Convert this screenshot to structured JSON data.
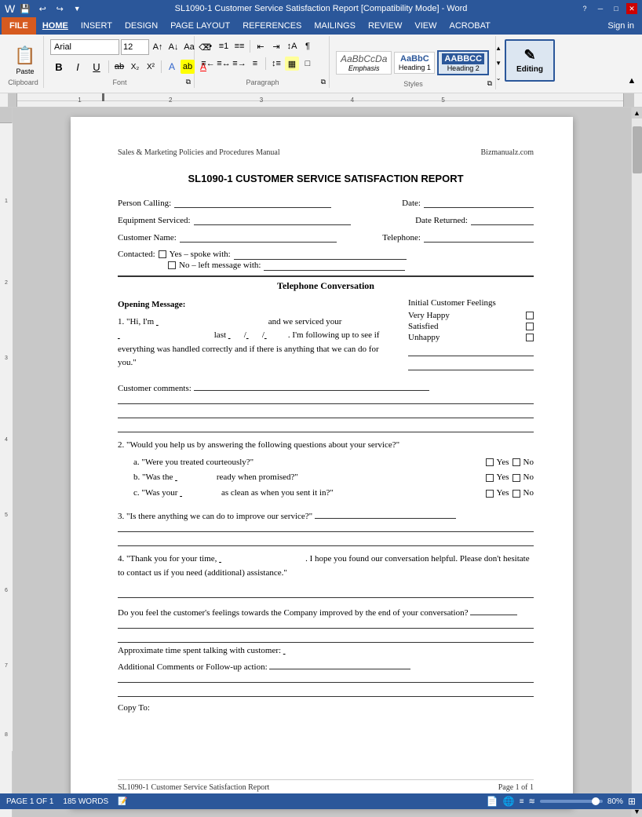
{
  "titleBar": {
    "quickAccess": [
      "save",
      "undo",
      "redo"
    ],
    "title": "SL1090-1 Customer Service Satisfaction Report [Compatibility Mode] - Word",
    "controls": [
      "minimize",
      "restore",
      "close"
    ],
    "helpIcon": "?"
  },
  "menuBar": {
    "fileBtn": "FILE",
    "tabs": [
      "HOME",
      "INSERT",
      "DESIGN",
      "PAGE LAYOUT",
      "REFERENCES",
      "MAILINGS",
      "REVIEW",
      "VIEW",
      "ACROBAT"
    ],
    "signIn": "Sign in"
  },
  "ribbon": {
    "clipboard": {
      "label": "Clipboard",
      "paste": "Paste"
    },
    "font": {
      "label": "Font",
      "name": "Arial",
      "size": "12",
      "boldLabel": "B",
      "italicLabel": "I",
      "underlineLabel": "U"
    },
    "paragraph": {
      "label": "Paragraph"
    },
    "styles": {
      "label": "Styles",
      "items": [
        {
          "name": "emphasis-style",
          "label": "AaBbCcDa",
          "sublabel": "Emphasis"
        },
        {
          "name": "heading1-style",
          "label": "AaBbC",
          "sublabel": "Heading 1"
        },
        {
          "name": "heading2-style",
          "label": "AABBCC",
          "sublabel": "Heading 2",
          "active": true
        }
      ]
    },
    "editing": {
      "label": "Editing"
    }
  },
  "document": {
    "header": {
      "left": "Sales & Marketing Policies and Procedures Manual",
      "right": "Bizmanualz.com"
    },
    "title": "SL1090-1 CUSTOMER SERVICE SATISFACTION REPORT",
    "fields": {
      "personCalling": "Person Calling:",
      "date": "Date:",
      "equipmentServiced": "Equipment Serviced:",
      "dateReturned": "Date Returned:",
      "customerName": "Customer Name:",
      "telephone": "Telephone:",
      "contacted": "Contacted:",
      "yesSpoke": "Yes – spoke with:",
      "noLeft": "No – left message with:"
    },
    "sections": {
      "telephoneConversation": "Telephone Conversation",
      "openingMessage": "Opening Message:",
      "initialCustomerFeelings": "Initial Customer Feelings",
      "checkboxes": [
        {
          "label": "Very Happy"
        },
        {
          "label": "Satisfied"
        },
        {
          "label": "Unhappy"
        }
      ],
      "openingText": "1. \"Hi, I'm __________________________ and we serviced your _________________________ last ____/____/____. I'm following up to see if everything was handled correctly and if there is anything that we can do for you.\"",
      "customerComments": "Customer comments:",
      "question2": "2. \"Would you help us by answering the following questions about your service?\"",
      "subQuestions": [
        {
          "letter": "a.",
          "text": "\"Were you treated courteously?\""
        },
        {
          "letter": "b.",
          "text": "\"Was the _________ ready when promised?\""
        },
        {
          "letter": "c.",
          "text": "\"Was your _________ as clean as when you sent it in?\""
        }
      ],
      "question3": "3. \"Is there anything we can do to improve our service?\"",
      "question4": "4. \"Thank you for your time, __________________. I hope you found our conversation helpful. Please don't hesitate to contact us if you need (additional) assistance.\"",
      "improvedQuestion": "Do you feel the customer's feelings towards the Company improved by the end of your conversation?",
      "approximateTime": "Approximate time spent talking with customer:",
      "additionalComments": "Additional Comments or Follow-up action:",
      "copyTo": "Copy To:"
    },
    "footer": {
      "left": "SL1090-1 Customer Service Satisfaction Report",
      "right": "Page 1 of 1"
    }
  },
  "statusBar": {
    "pageInfo": "PAGE 1 OF 1",
    "wordCount": "185 WORDS",
    "zoom": "80%"
  }
}
